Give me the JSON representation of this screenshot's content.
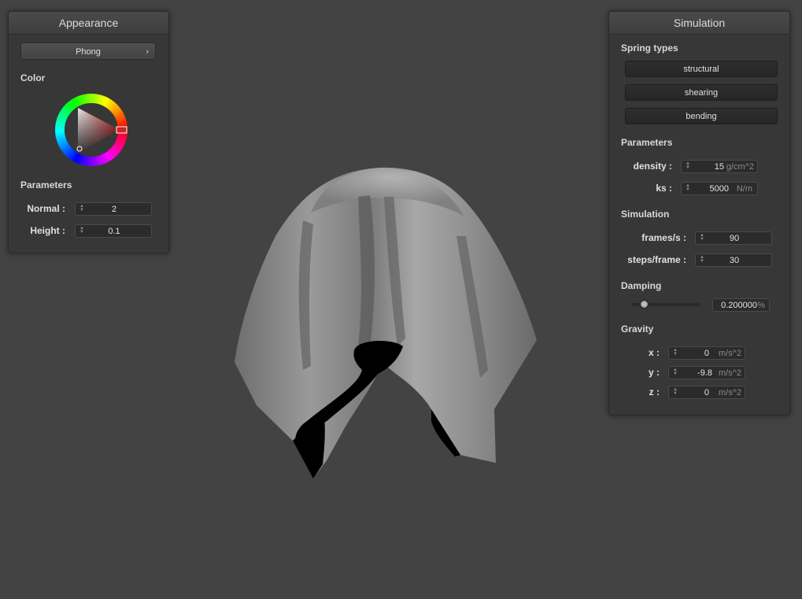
{
  "appearance": {
    "title": "Appearance",
    "shader": {
      "selected": "Phong"
    },
    "color_label": "Color",
    "color_value": "#c62828",
    "parameters_label": "Parameters",
    "normal": {
      "label": "Normal :",
      "value": "2"
    },
    "height": {
      "label": "Height :",
      "value": "0.1"
    }
  },
  "simulation": {
    "title": "Simulation",
    "spring_types": {
      "label": "Spring types",
      "buttons": [
        "structural",
        "shearing",
        "bending"
      ]
    },
    "parameters": {
      "label": "Parameters",
      "density": {
        "label": "density :",
        "value": "15",
        "unit": "g/cm^2"
      },
      "ks": {
        "label": "ks :",
        "value": "5000",
        "unit": "N/m"
      }
    },
    "sim_section": {
      "label": "Simulation",
      "frames": {
        "label": "frames/s :",
        "value": "90"
      },
      "steps": {
        "label": "steps/frame :",
        "value": "30"
      }
    },
    "damping": {
      "label": "Damping",
      "value": "0.200000",
      "unit": "%",
      "slider_fraction": 0.2
    },
    "gravity": {
      "label": "Gravity",
      "x": {
        "label": "x :",
        "value": "0",
        "unit": "m/s^2"
      },
      "y": {
        "label": "y :",
        "value": "-9.8",
        "unit": "m/s^2"
      },
      "z": {
        "label": "z :",
        "value": "0",
        "unit": "m/s^2"
      }
    }
  },
  "colors": {
    "background": "#434343",
    "panel": "#373737",
    "cloth": "#8a8a8a"
  }
}
